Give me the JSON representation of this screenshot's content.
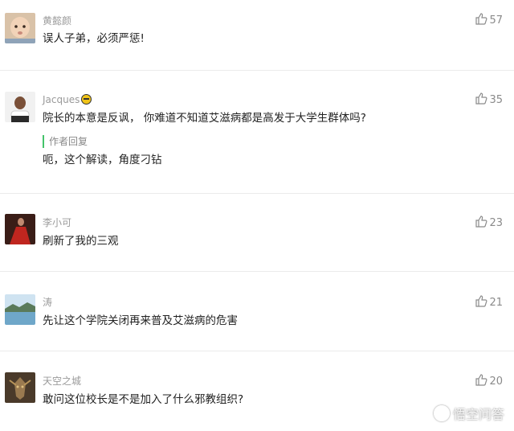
{
  "comments": [
    {
      "username": "黄懿颜",
      "text": "误人子弟，必须严惩!",
      "likes": "57",
      "avatar_icon": "baby-photo"
    },
    {
      "username": "Jacques",
      "text": "院长的本意是反讽， 你难道不知道艾滋病都是高发于大学生群体吗?",
      "likes": "35",
      "avatar_icon": "man-photo",
      "badge_icon": "level-badge",
      "reply": {
        "label": "作者回复",
        "text": "呃，这个解读，角度刁钻"
      }
    },
    {
      "username": "李小可",
      "text": "刷新了我的三观",
      "likes": "23",
      "avatar_icon": "woman-red-dress-photo"
    },
    {
      "username": "涛",
      "text": "先让这个学院关闭再来普及艾滋病的危害",
      "likes": "21",
      "avatar_icon": "lake-landscape-photo"
    },
    {
      "username": "天空之城",
      "text": "敢问这位校长是不是加入了什么邪教组织?",
      "likes": "20",
      "avatar_icon": "dark-creature-photo"
    }
  ],
  "watermark": {
    "text": "悟空问答"
  },
  "colors": {
    "accent_reply_bar": "#44c36a",
    "divider": "#ebebeb"
  }
}
